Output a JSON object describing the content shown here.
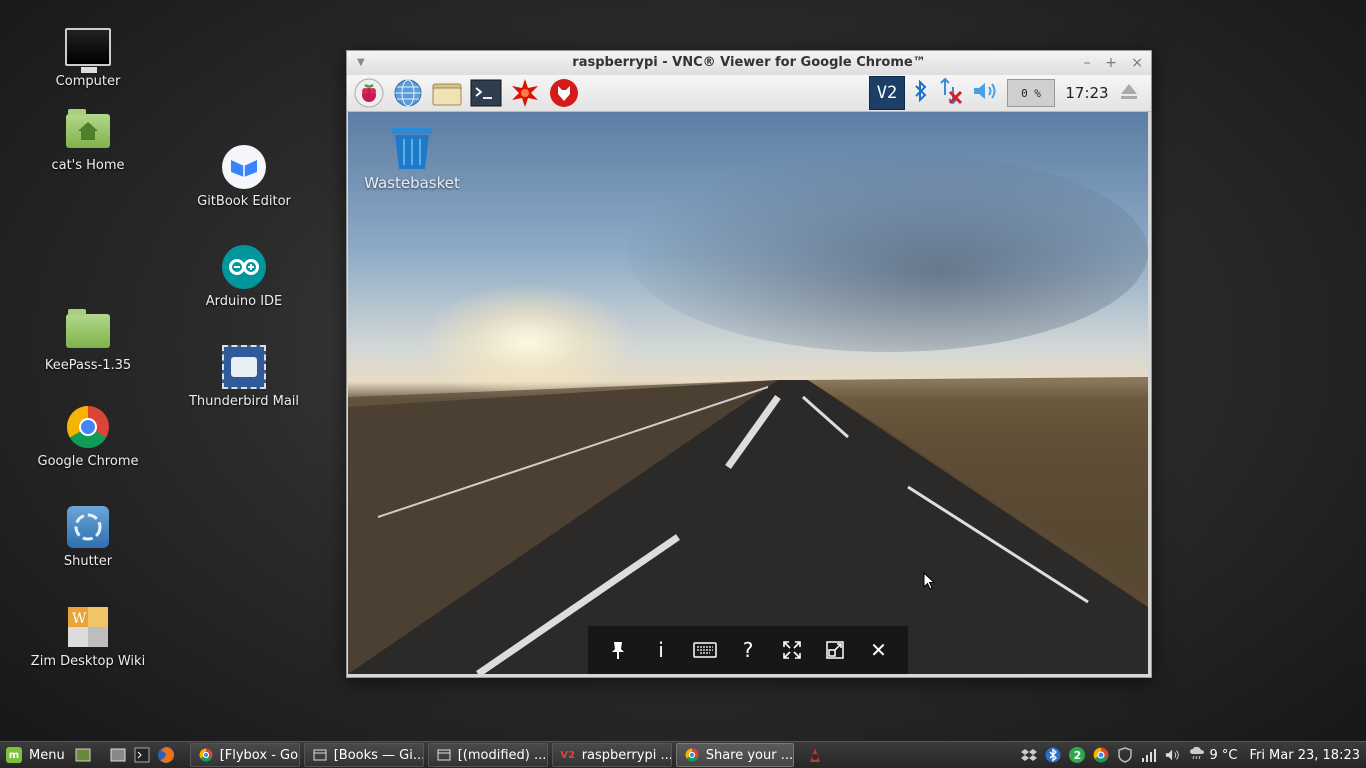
{
  "desktop": {
    "icons_left": [
      {
        "label": "Computer"
      },
      {
        "label": "cat's Home"
      },
      {
        "label": "KeePass-1.35"
      },
      {
        "label": "Google Chrome"
      },
      {
        "label": "Shutter"
      },
      {
        "label": "Zim Desktop Wiki"
      }
    ],
    "icons_right": [
      {
        "label": "GitBook Editor"
      },
      {
        "label": "Arduino IDE"
      },
      {
        "label": "Thunderbird Mail"
      }
    ]
  },
  "window": {
    "title": "raspberrypi - VNC® Viewer for Google Chrome™",
    "controls": {
      "minimize": "–",
      "maximize": "+",
      "close": "×"
    }
  },
  "pi_panel": {
    "launchers": [
      "raspberry-icon",
      "globe-icon",
      "files-icon",
      "terminal-icon",
      "mathematica-icon",
      "wolfram-icon"
    ],
    "cpu": "0 %",
    "clock": "17:23",
    "tray_icons": [
      "vnc-icon",
      "bluetooth-icon",
      "network-disconnected-icon",
      "volume-icon",
      "eject-icon"
    ]
  },
  "remote_desktop": {
    "wastebasket_label": "Wastebasket"
  },
  "vnc_toolbar": {
    "buttons": [
      "pin-icon",
      "info-icon",
      "keyboard-icon",
      "help-icon",
      "fullscreen-icon",
      "scale-icon",
      "close-icon"
    ],
    "labels": {
      "info": "i",
      "help": "?",
      "close": "✕"
    }
  },
  "taskbar": {
    "menu_label": "Menu",
    "tasks": [
      {
        "label": "[Flybox - Go...",
        "icon": "chrome-icon",
        "active": false
      },
      {
        "label": "[Books — Gi...",
        "icon": "window-icon",
        "active": false
      },
      {
        "label": "[(modified) ...",
        "icon": "window-icon",
        "active": false
      },
      {
        "label": "raspberrypi ...",
        "icon": "vnc-icon",
        "active": false
      },
      {
        "label": "Share your ...",
        "icon": "chrome-icon",
        "active": true
      }
    ],
    "tray": {
      "badge_count": "2",
      "weather": "9 °C",
      "datetime": "Fri Mar 23, 18:23"
    }
  },
  "colors": {
    "accent_green": "#7fbf3f",
    "vnc_blue": "#1d5fa8"
  }
}
